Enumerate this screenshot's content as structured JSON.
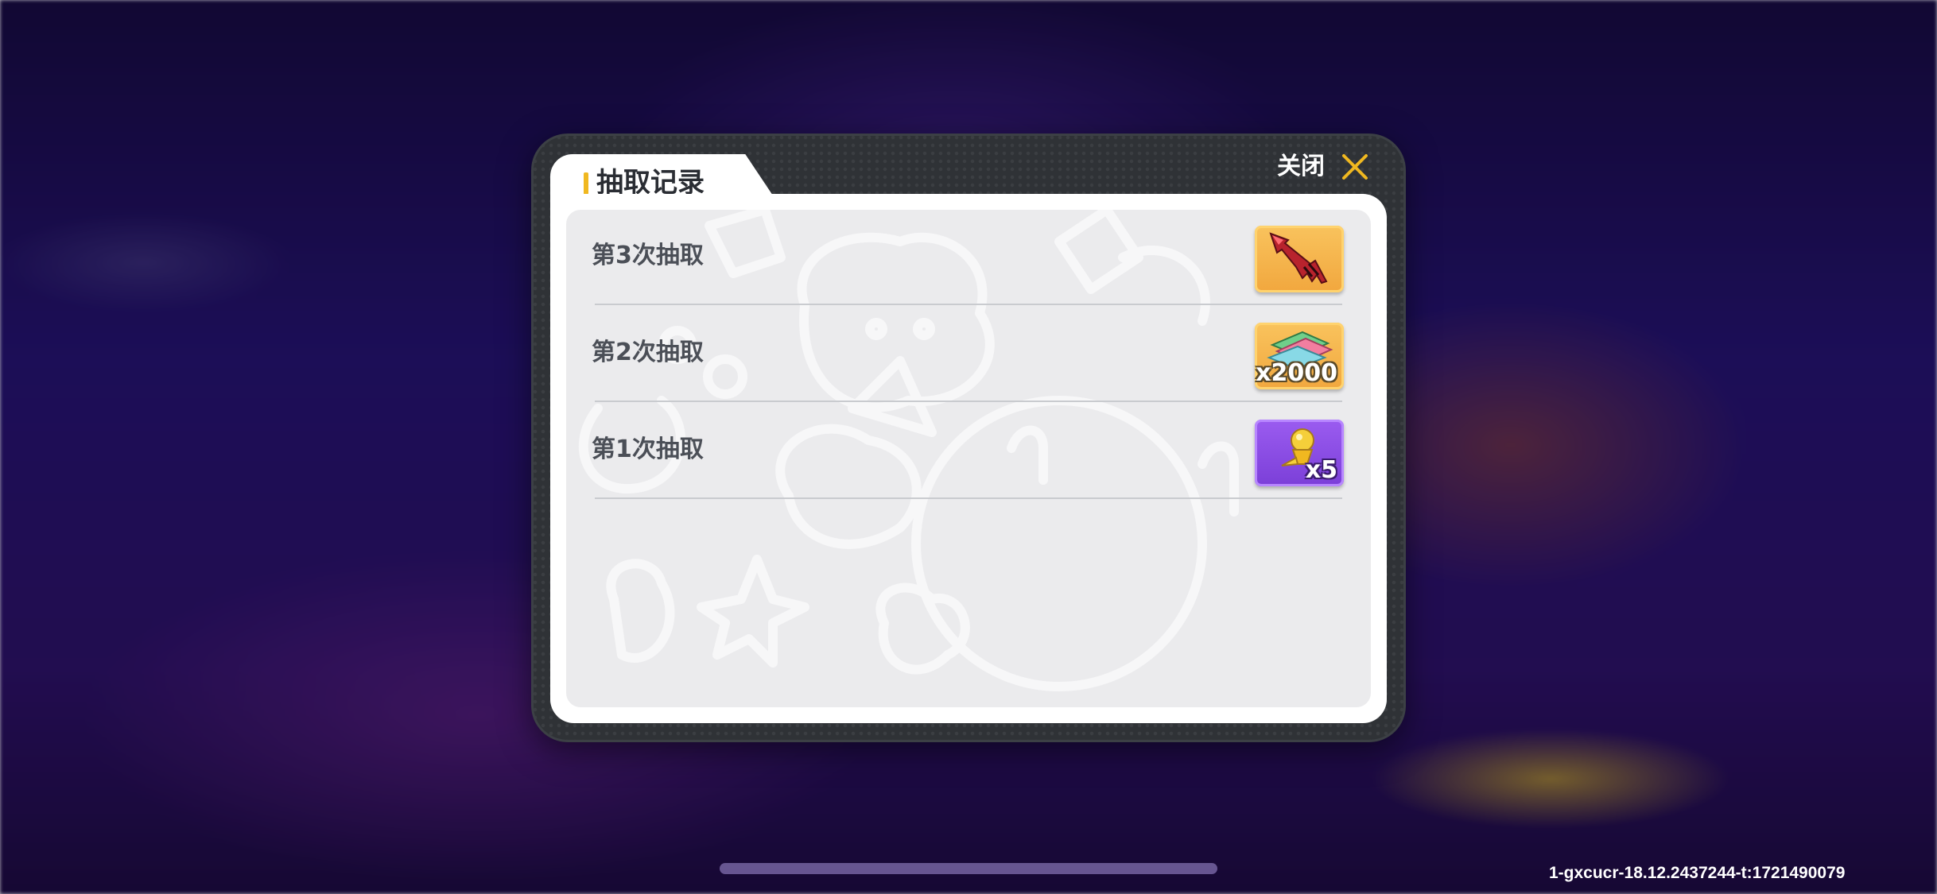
{
  "dialog": {
    "title": "抽取记录",
    "close_label": "关闭",
    "close_icon": "close-x-icon",
    "accent_color": "#f0b820"
  },
  "records": [
    {
      "label": "第3次抽取",
      "reward_icon": "red-claw-weapon-icon",
      "reward_bg": "gold",
      "quantity": ""
    },
    {
      "label": "第2次抽取",
      "reward_icon": "ticket-stack-icon",
      "reward_bg": "gold",
      "quantity": "x2000"
    },
    {
      "label": "第1次抽取",
      "reward_icon": "golden-trophy-icon",
      "reward_bg": "purple",
      "quantity": "x5"
    }
  ],
  "footer": {
    "build_info": "1-gxcucr-18.12.2437244-t:1721490079"
  }
}
